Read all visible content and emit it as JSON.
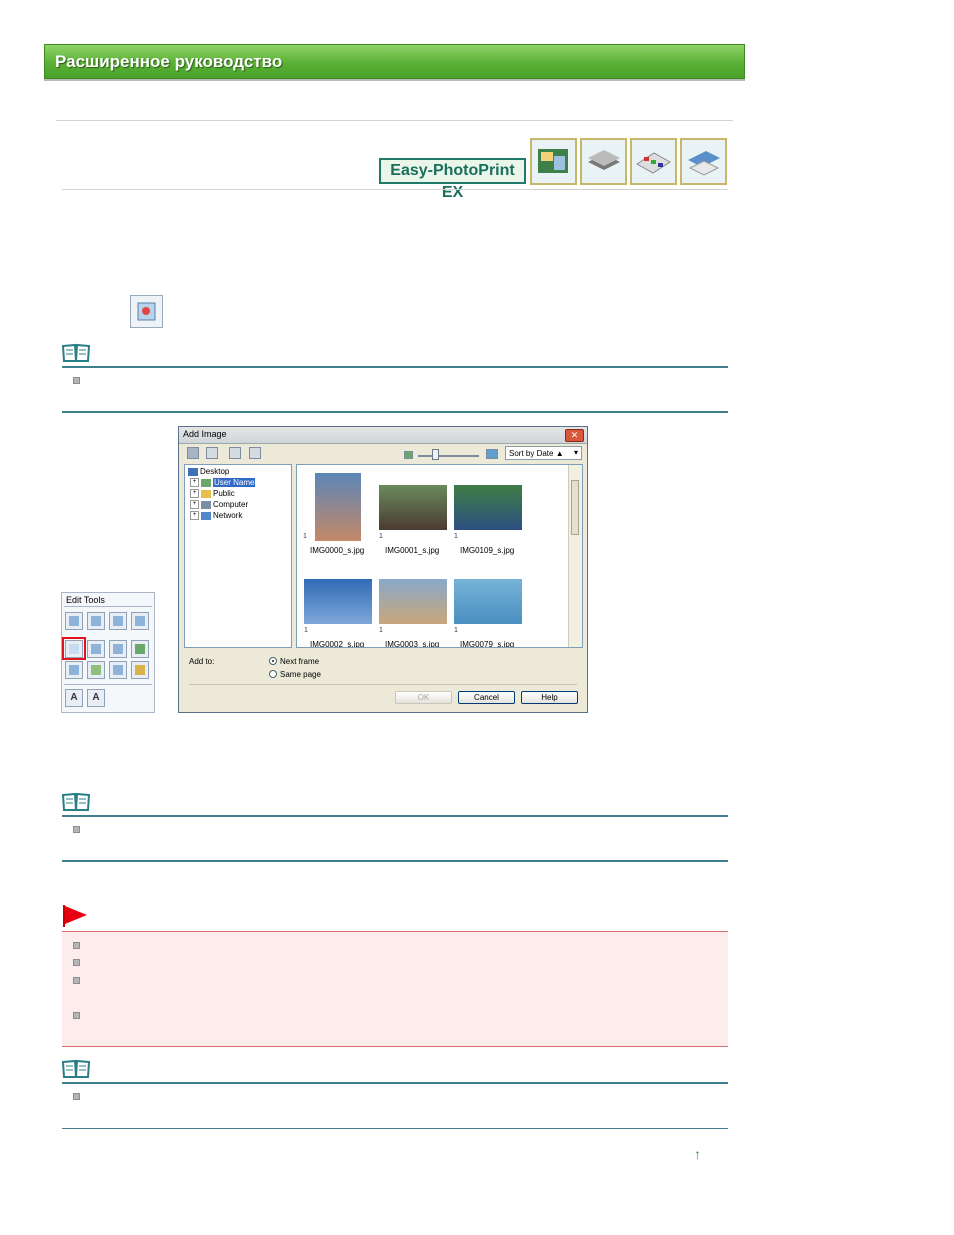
{
  "header": {
    "title": "Расширенное руководство"
  },
  "product": {
    "logo_text": "Easy-PhotoPrint EX"
  },
  "dialog": {
    "title": "Add Image",
    "close": "✕",
    "sort_label": "Sort by Date ▲",
    "sort_arrow": "▾",
    "tree": [
      "Desktop",
      "User Name",
      "Public",
      "Computer",
      "Network"
    ],
    "photos": [
      {
        "name": "IMG0000_s.jpg",
        "count": "1",
        "color_top": "#5c86b7",
        "color_bot": "#c48868"
      },
      {
        "name": "IMG0001_s.jpg",
        "count": "1",
        "color_top": "#6b8a5c",
        "color_bot": "#4b3b31"
      },
      {
        "name": "IMG0109_s.jpg",
        "count": "1",
        "color_top": "#3e7e45",
        "color_bot": "#2c4f80"
      },
      {
        "name": "IMG0002_s.jpg",
        "count": "1",
        "color_top": "#2f6cb6",
        "color_bot": "#7fa6d9"
      },
      {
        "name": "IMG0003_s.jpg",
        "count": "1",
        "color_top": "#8aa9c9",
        "color_bot": "#c9a67a"
      },
      {
        "name": "IMG0079_s.jpg",
        "count": "1",
        "color_top": "#77b3d8",
        "color_bot": "#4a8fc0"
      }
    ],
    "add_to_label": "Add to:",
    "option_next": "Next frame",
    "option_same": "Same page",
    "ok": "OK",
    "cancel": "Cancel",
    "help": "Help"
  },
  "tools": {
    "title": "Edit Tools",
    "text_a": "A",
    "text_a2": "A"
  },
  "top_link": "↑"
}
